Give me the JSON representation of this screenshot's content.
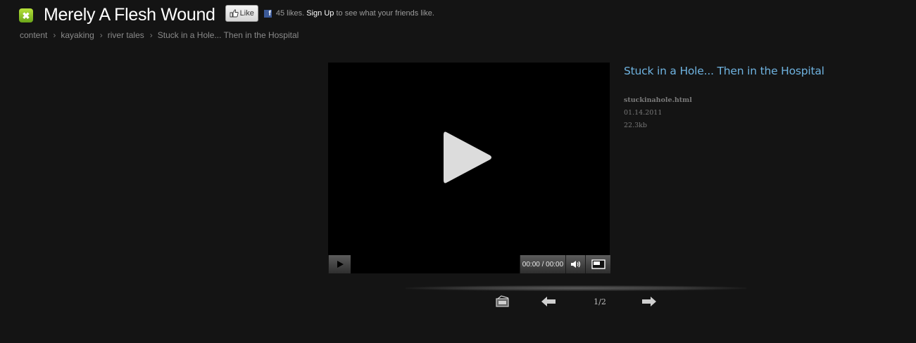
{
  "header": {
    "logo_glyph": "✖",
    "site_title": "Merely A Flesh Wound",
    "like_button": "Like",
    "fb_icon": "f",
    "likes_text": "45 likes.",
    "signup_link": "Sign Up",
    "signup_suffix": "to see what your friends like."
  },
  "breadcrumb": {
    "items": [
      "content",
      "kayaking",
      "river tales"
    ],
    "separator": "›",
    "current": "Stuck in a Hole... Then in the Hospital"
  },
  "player": {
    "time": "00:00 / 00:00",
    "icons": [
      "play-icon",
      "volume-icon",
      "fullscreen-icon"
    ]
  },
  "info": {
    "title": "Stuck in a Hole... Then in the Hospital",
    "filename": "stuckinahole.html",
    "date": "01.14.2011",
    "size": "22.3kb"
  },
  "pager": {
    "counter": "1/2",
    "icons": [
      "gallery-icon",
      "arrow-left-icon",
      "arrow-right-icon"
    ]
  },
  "colors": {
    "background": "#141414",
    "title_link": "#6fb3e0",
    "logo_green": "#8cc327"
  }
}
